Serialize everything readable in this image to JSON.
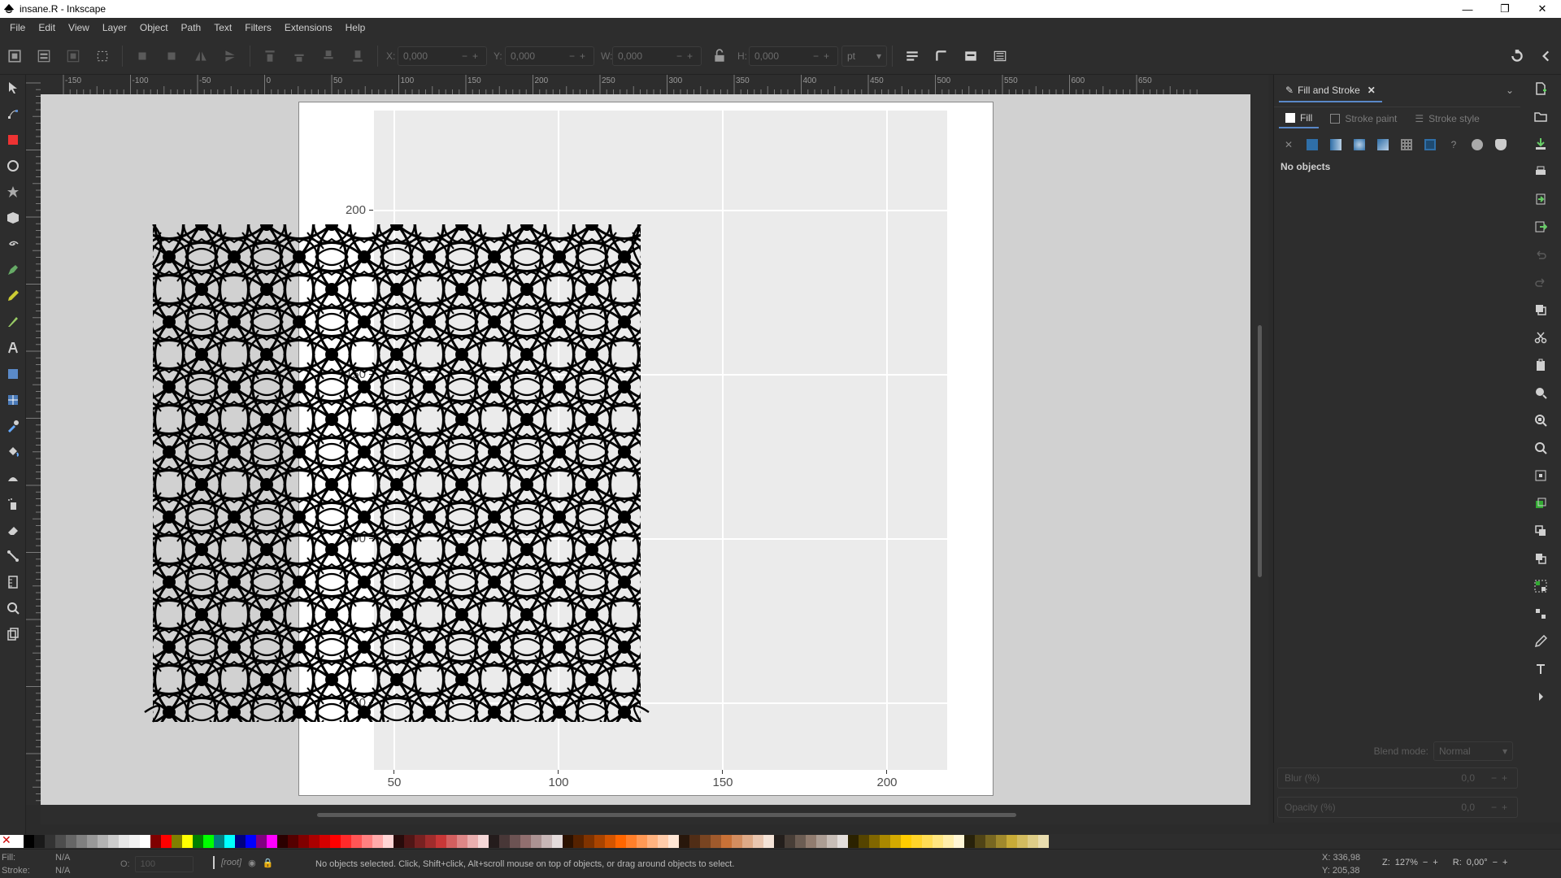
{
  "window": {
    "title": "insane.R - Inkscape",
    "minimize": "—",
    "maximize": "❐",
    "close": "✕"
  },
  "menu": [
    "File",
    "Edit",
    "View",
    "Layer",
    "Object",
    "Path",
    "Text",
    "Filters",
    "Extensions",
    "Help"
  ],
  "toolbar": {
    "x_label": "X:",
    "x_value": "0,000",
    "y_label": "Y:",
    "y_value": "0,000",
    "w_label": "W:",
    "w_value": "0,000",
    "h_label": "H:",
    "h_value": "0,000",
    "unit": "pt"
  },
  "ruler_top": [
    "-150",
    "-100",
    "-50",
    "0",
    "50",
    "100",
    "150",
    "200",
    "250",
    "300",
    "350",
    "400",
    "450",
    "500",
    "550",
    "600",
    "650"
  ],
  "plot": {
    "y_ticks": [
      "200",
      "150",
      "100",
      "50"
    ],
    "x_ticks": [
      "50",
      "100",
      "150",
      "200"
    ]
  },
  "dock": {
    "tab_label": "Fill and Stroke",
    "subtabs": {
      "fill": "Fill",
      "stroke_paint": "Stroke paint",
      "stroke_style": "Stroke style"
    },
    "paint_none": "✕",
    "paint_unknown": "?",
    "no_objects": "No objects",
    "blend_label": "Blend mode:",
    "blend_value": "Normal",
    "blur_label": "Blur (%)",
    "blur_value": "0,0",
    "opacity_label": "Opacity (%)",
    "opacity_value": "0,0"
  },
  "status": {
    "fill_label": "Fill:",
    "fill_value": "N/A",
    "stroke_label": "Stroke:",
    "stroke_value": "N/A",
    "o_label": "O:",
    "o_value": "100",
    "layer": "[root]",
    "message": "No objects selected. Click, Shift+click, Alt+scroll mouse on top of objects, or drag around objects to select.",
    "x_coord": "X:  336,98",
    "y_coord": "Y:  205,38",
    "z_label": "Z:",
    "zoom": "127%",
    "r_label": "R:",
    "rotation": "0,00°"
  },
  "palette": [
    "#ffffff",
    "#000000",
    "#1a1a1a",
    "#333333",
    "#4d4d4d",
    "#666666",
    "#808080",
    "#999999",
    "#b3b3b3",
    "#cccccc",
    "#e6e6e6",
    "#f2f2f2",
    "#ffffff",
    "#800000",
    "#ff0000",
    "#808000",
    "#ffff00",
    "#008000",
    "#00ff00",
    "#008080",
    "#00ffff",
    "#000080",
    "#0000ff",
    "#800080",
    "#ff00ff",
    "#2b0000",
    "#550000",
    "#800000",
    "#aa0000",
    "#d40000",
    "#ff0000",
    "#ff2a2a",
    "#ff5555",
    "#ff8080",
    "#ffaaaa",
    "#ffd5d5",
    "#280b0b",
    "#501616",
    "#782121",
    "#a02c2c",
    "#c83737",
    "#d35f5f",
    "#de8787",
    "#e9afaf",
    "#f4d7d7",
    "#241c1c",
    "#483737",
    "#6c5353",
    "#916f6f",
    "#ac9393",
    "#c8b7b7",
    "#e3dbdb",
    "#2b1100",
    "#552200",
    "#803300",
    "#aa4400",
    "#d45500",
    "#ff6600",
    "#ff7f2a",
    "#ff9955",
    "#ffb380",
    "#ffccaa",
    "#ffe6d5",
    "#28170b",
    "#502d16",
    "#784421",
    "#a05a2c",
    "#c87137",
    "#d38d5f",
    "#deaa87",
    "#e9c6af",
    "#f4e3d7",
    "#241f1c",
    "#483e37",
    "#6c5d53",
    "#917c6f",
    "#ac9d93",
    "#c8beb7",
    "#e3dedb",
    "#2b2200",
    "#554400",
    "#806600",
    "#aa8800",
    "#d4aa00",
    "#ffcc00",
    "#ffd42a",
    "#ffdd55",
    "#ffe680",
    "#ffeeaa",
    "#fff6d5",
    "#28220b",
    "#504416",
    "#786721",
    "#a0892c",
    "#c8ab37",
    "#d3bc5f",
    "#decd87",
    "#e9ddaf"
  ]
}
